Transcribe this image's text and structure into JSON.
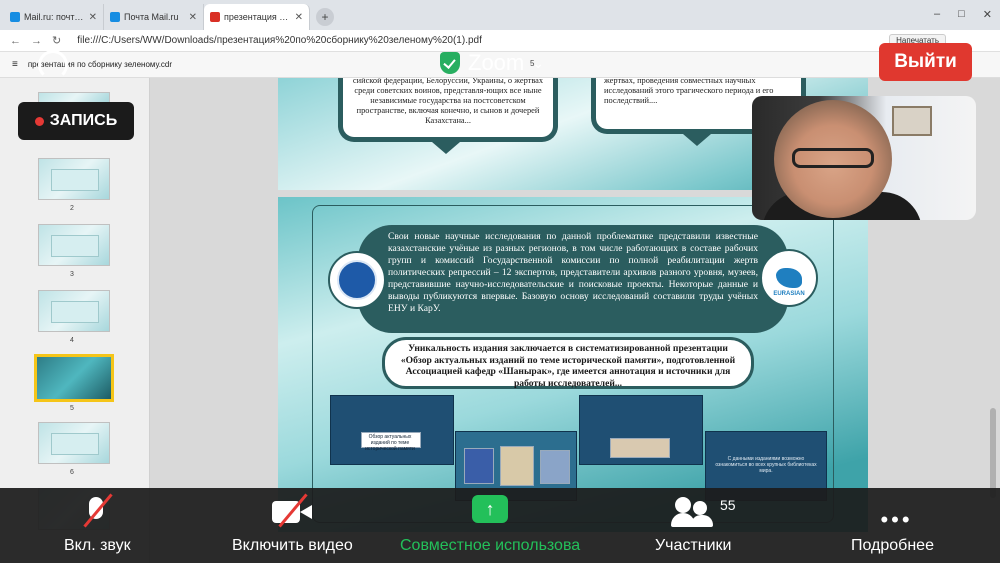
{
  "browser": {
    "tabs": [
      {
        "label": "Mail.ru: почта, поиск в инт",
        "favicon_color": "#168de2",
        "active": false
      },
      {
        "label": "Почта Mail.ru",
        "favicon_color": "#168de2",
        "active": false
      },
      {
        "label": "презентация по сборн",
        "favicon_color": "#d93025",
        "active": true
      }
    ],
    "new_tab": "+",
    "url": "file:///C:/Users/WW/Downloads/презентация%20по%20сборнику%20зеленому%20(1).pdf",
    "print_button": "Напечатать"
  },
  "pdf_viewer": {
    "document_name": "презентация по сборнику зеленому.cdr",
    "page_indicator": "5",
    "thumbnails": [
      {
        "num": "2"
      },
      {
        "num": "3"
      },
      {
        "num": "4"
      },
      {
        "num": "5",
        "selected": true
      },
      {
        "num": "6"
      }
    ]
  },
  "slide_top": {
    "left_text": "сийской федерации, Белоруссии, Украины, о жертвах среди советских воинов, представля-ющих все ныне независимые государства на постсоветском пространстве, включая конечно, и сынов и дочерей Казахстана...",
    "right_text": "жертвах, проведения совместных научных исследований этого трагического периода и его последствий...."
  },
  "slide_main": {
    "dark_text": "Свои новые научные исследования по данной проблематике представили известные казахстанские учёные из разных регионов, в том числе работающих в составе рабочих групп и комиссий Государственной комиссии по полной реабилитации жертв политических репрессий – 12 экспертов, представители архивов разного уровня, музеев, представившие научно-исследовательские и поисковые проекты. Некоторые данные и выводы публикуются впервые. Базовую основу исследований составили труды учёных ЕНУ и КарУ.",
    "white_text": "Уникальность издания заключается в систематизированной презентации «Обзор актуальных изданий по теме исторической памяти», подготовленной Ассоциацией кафедр «Шанырак», где имеется аннотация и источники для работы исследователей...",
    "logo_right_label": "EURASIAN",
    "photo_caption_1": "Обзор актуальных изданий по теме исторической памяти",
    "photo_caption_2": "С данными изданиями возможно ознакомиться во всех крупных библиотеках мира."
  },
  "zoom": {
    "title": "Zoom",
    "exit_label": "Выйти",
    "record_label": "ЗАПИСЬ",
    "toolbar": {
      "unmute": "Вкл. звук",
      "start_video": "Включить видео",
      "share": "Совместное использова",
      "participants": "Участники",
      "participants_count": "55",
      "more": "Подробнее"
    },
    "colors": {
      "exit": "#e0382f",
      "share": "#23c05a",
      "record_dot": "#e53935"
    }
  }
}
